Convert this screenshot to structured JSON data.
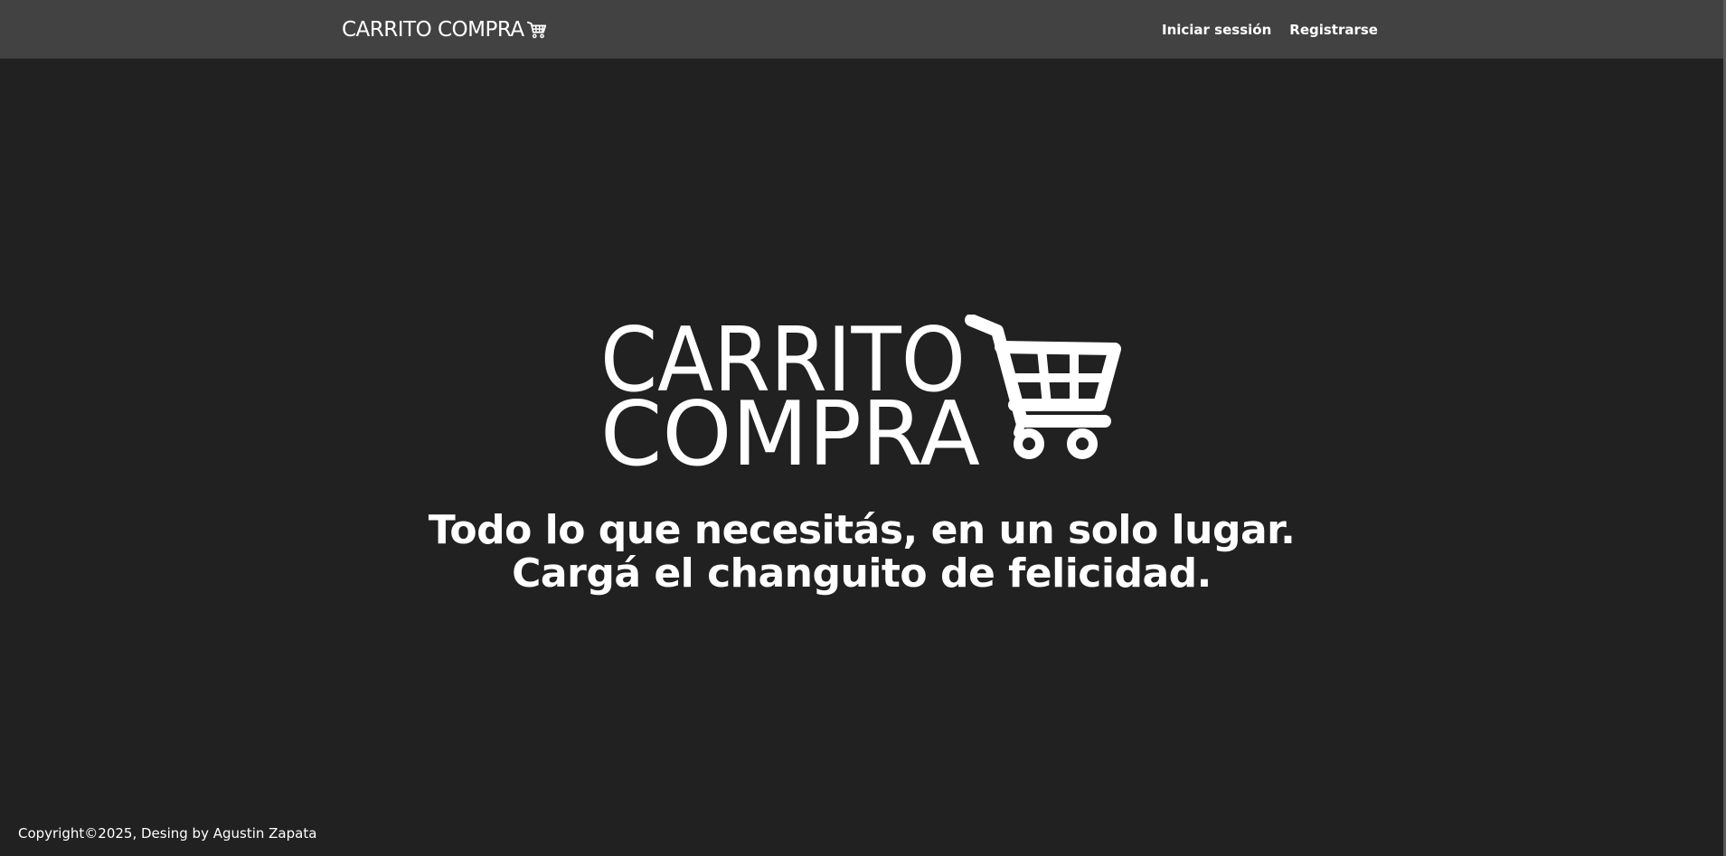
{
  "navbar": {
    "brand_text": "CARRITO COMPRA",
    "brand_icon": "shopping-cart-icon",
    "links": [
      {
        "label": "Iniciar sessión"
      },
      {
        "label": "Registrarse"
      }
    ]
  },
  "hero": {
    "logo_line1": "CARRITO",
    "logo_line2": "COMPRA",
    "logo_icon": "shopping-cart-icon",
    "tagline_line1": "Todo lo que necesitás, en un solo lugar.",
    "tagline_line2": "Cargá el changuito de felicidad."
  },
  "footer": {
    "text": "Copyright©2025, Desing by Agustin Zapata"
  },
  "colors": {
    "background": "#212121",
    "navbar": "#424242",
    "text": "#ffffff"
  }
}
